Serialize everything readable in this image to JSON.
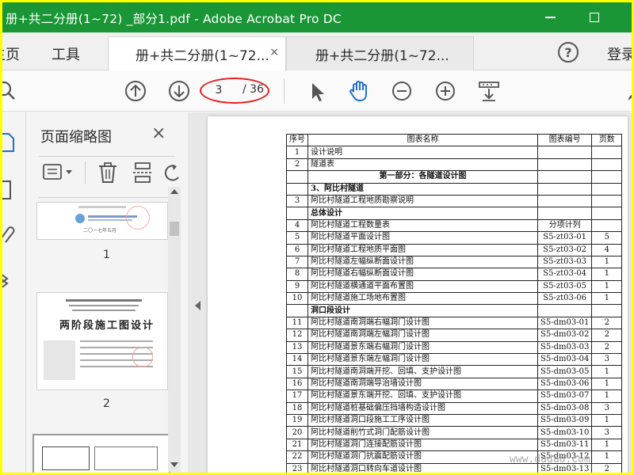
{
  "window": {
    "title": "册+共二分册(1~72)  _部分1.pdf - Adobe Acrobat Pro DC",
    "minimize_symbol": "minimize-icon",
    "maximize_symbol": "maximize-icon"
  },
  "menu": {
    "home": "主页",
    "tools": "工具",
    "login": "登录"
  },
  "tabs": [
    {
      "label": "册+共二分册(1~72...",
      "close": "×",
      "active": true
    },
    {
      "label": "册+共二分册(1~72...",
      "active": false
    }
  ],
  "toolbar": {
    "current_page": "3",
    "total_pages": "/ 36",
    "icons": [
      "search-icon",
      "page-up-icon",
      "page-down-icon",
      "select-cursor-icon",
      "hand-tool-icon",
      "zoom-out-icon",
      "zoom-in-icon",
      "scroll-mode-icon"
    ]
  },
  "thumbnail_panel": {
    "title": "页面缩略图",
    "close": "×",
    "thumbnails": [
      {
        "number": "1",
        "caption": "二〇一七年五月"
      },
      {
        "number": "2",
        "heading": "两阶段施工图设计"
      }
    ]
  },
  "colors": {
    "titlebar": "#1a9636",
    "highlight_oval": "#e02020",
    "hand_tool": "#1f6fd1"
  },
  "document": {
    "header": [
      "序号",
      "图表名称",
      "图表编号",
      "页数"
    ],
    "rows": [
      {
        "type": "row",
        "cells": [
          "1",
          "设计说明",
          "",
          ""
        ]
      },
      {
        "type": "row",
        "cells": [
          "2",
          "隧道表",
          "",
          ""
        ]
      },
      {
        "type": "sec",
        "cells": [
          "",
          "第一部分：各隧道设计图",
          "",
          ""
        ]
      },
      {
        "type": "bold",
        "cells": [
          "",
          "3、阿比村隧道",
          "",
          ""
        ]
      },
      {
        "type": "row",
        "cells": [
          "3",
          "阿比村隧道工程地质勘察说明",
          "",
          ""
        ]
      },
      {
        "type": "bold",
        "cells": [
          "",
          "总体设计",
          "",
          ""
        ]
      },
      {
        "type": "row",
        "cells": [
          "4",
          "阿比村隧道工程数量表",
          "分项计列",
          ""
        ]
      },
      {
        "type": "row",
        "cells": [
          "5",
          "阿比村隧道平面设计图",
          "S5-zt03-01",
          "5"
        ]
      },
      {
        "type": "row",
        "cells": [
          "6",
          "阿比村隧道工程地质平面图",
          "S5-zt03-02",
          "4"
        ]
      },
      {
        "type": "row",
        "cells": [
          "7",
          "阿比村隧道左幅纵断面设计图",
          "S5-zt03-03",
          "1"
        ]
      },
      {
        "type": "row",
        "cells": [
          "8",
          "阿比村隧道右幅纵断面设计图",
          "S5-zt03-04",
          "1"
        ]
      },
      {
        "type": "row",
        "cells": [
          "9",
          "阿比村隧道横通道平面布置图",
          "S5-zt03-05",
          "1"
        ]
      },
      {
        "type": "row",
        "cells": [
          "10",
          "阿比村隧道施工场地布置图",
          "S5-zt03-06",
          "1"
        ]
      },
      {
        "type": "bold",
        "cells": [
          "",
          "洞口段设计",
          "",
          ""
        ]
      },
      {
        "type": "row",
        "cells": [
          "11",
          "阿比村隧道南洞端右幅洞门设计图",
          "S5-dm03-01",
          "2"
        ]
      },
      {
        "type": "row",
        "cells": [
          "12",
          "阿比村隧道南洞端左幅洞门设计图",
          "S5-dm03-02",
          "2"
        ]
      },
      {
        "type": "row",
        "cells": [
          "13",
          "阿比村隧道景东端右幅洞门设计图",
          "S5-dm03-03",
          "2"
        ]
      },
      {
        "type": "row",
        "cells": [
          "14",
          "阿比村隧道景东端左幅洞门设计图",
          "S5-dm03-04",
          "3"
        ]
      },
      {
        "type": "row",
        "cells": [
          "15",
          "阿比村隧道南洞端开挖、回填、支护设计图",
          "S5-dm03-05",
          "1"
        ]
      },
      {
        "type": "row",
        "cells": [
          "16",
          "阿比村隧道南洞端导治墙设计图",
          "S5-dm03-06",
          "1"
        ]
      },
      {
        "type": "row",
        "cells": [
          "17",
          "阿比村隧道景东端开挖、回填、支护设计图",
          "S5-dm03-07",
          "1"
        ]
      },
      {
        "type": "row",
        "cells": [
          "18",
          "阿比村隧道桩基础偏压挡墙构造设计图",
          "S5-dm03-08",
          "3"
        ]
      },
      {
        "type": "row",
        "cells": [
          "19",
          "阿比村隧道洞口段施工工序设计图",
          "S5-dm03-09",
          "1"
        ]
      },
      {
        "type": "row",
        "cells": [
          "20",
          "阿比村隧道削竹式洞门配筋设计图",
          "S5-dm03-10",
          "3"
        ]
      },
      {
        "type": "row",
        "cells": [
          "21",
          "阿比村隧道洞门连接配筋设计图",
          "S5-dm03-11",
          "1"
        ]
      },
      {
        "type": "row",
        "cells": [
          "22",
          "阿比村隧道洞门抗震配筋设计图",
          "S5-dm03-12",
          "1"
        ]
      },
      {
        "type": "row",
        "cells": [
          "23",
          "阿比村隧道洞口转向车道设计图",
          "S5-dm03-13",
          "2"
        ]
      }
    ]
  },
  "watermark": "www.dadao.com"
}
